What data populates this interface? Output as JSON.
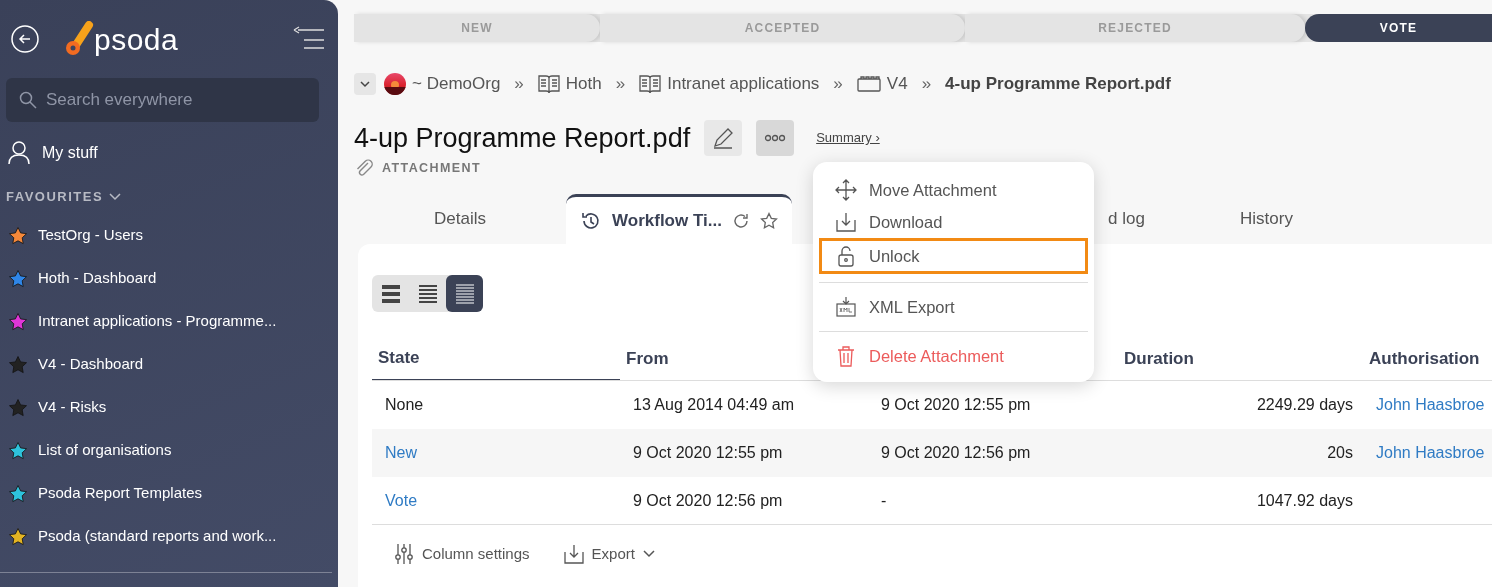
{
  "sidebar": {
    "logo": "psoda",
    "search": {
      "placeholder": "Search everywhere"
    },
    "my_stuff": "My stuff",
    "favourites": {
      "title": "FAVOURITES",
      "expanded": true,
      "items": [
        {
          "label": "TestOrg - Users",
          "color": "#f5883a"
        },
        {
          "label": "Hoth - Dashboard",
          "color": "#2f86e8"
        },
        {
          "label": "Intranet applications - Programme...",
          "color": "#e036d8"
        },
        {
          "label": "V4 - Dashboard",
          "color": "#222222"
        },
        {
          "label": "V4 - Risks",
          "color": "#222222"
        },
        {
          "label": "List of organisations",
          "color": "#2ec3dc"
        },
        {
          "label": "Psoda Report Templates",
          "color": "#2ec3dc"
        },
        {
          "label": "Psoda (standard reports and work...",
          "color": "#e3b423"
        }
      ]
    }
  },
  "stages": [
    {
      "label": "NEW",
      "selected": false
    },
    {
      "label": "ACCEPTED",
      "selected": false
    },
    {
      "label": "REJECTED",
      "selected": false
    },
    {
      "label": "VOTE",
      "selected": true
    }
  ],
  "breadcrumb": {
    "items": [
      {
        "label": "~ DemoOrg",
        "kind": "org",
        "separator": "»"
      },
      {
        "label": "Hoth",
        "kind": "book",
        "separator": "»"
      },
      {
        "label": "Intranet applications",
        "kind": "book",
        "separator": "»"
      },
      {
        "label": "V4",
        "kind": "board",
        "separator": "»"
      }
    ],
    "current": "4-up Programme Report.pdf"
  },
  "title": "4-up Programme Report.pdf",
  "summary_link": "Summary ›",
  "type_label": "ATTACHMENT",
  "tabs": [
    {
      "label": "Details",
      "selected": false
    },
    {
      "label": "Workflow Ti...",
      "selected": true
    },
    {
      "label": "d log",
      "selected": false
    },
    {
      "label": "History",
      "selected": false
    }
  ],
  "menu": [
    {
      "label": "Move Attachment",
      "kind": "move",
      "highlighted": false
    },
    {
      "label": "Download",
      "kind": "download",
      "highlighted": false
    },
    {
      "label": "Unlock",
      "kind": "unlock",
      "highlighted": true
    },
    {
      "label": "XML Export",
      "kind": "xml",
      "highlighted": false
    },
    {
      "label": "Delete Attachment",
      "kind": "delete",
      "highlighted": false
    }
  ],
  "view_modes": [
    {
      "selected": false
    },
    {
      "selected": false
    },
    {
      "selected": true
    }
  ],
  "table": {
    "columns": {
      "state": "State",
      "from": "From",
      "duration": "Duration",
      "authorisation": "Authorisation"
    },
    "rows": [
      {
        "state": "None",
        "link": false,
        "from": "13 Aug 2014 04:49 am",
        "column_3": "9 Oct 2020 12:55 pm",
        "duration": "2249.29 days",
        "authorisation": "John Haasbroe"
      },
      {
        "state": "New",
        "link": true,
        "from": "9 Oct 2020 12:55 pm",
        "column_3": "9 Oct 2020 12:56 pm",
        "duration": "20s",
        "authorisation": "John Haasbroe"
      },
      {
        "state": "Vote",
        "link": true,
        "from": "9 Oct 2020 12:56 pm",
        "column_3": "-",
        "duration": "1047.92 days"
      }
    ]
  },
  "footer": {
    "column_settings": "Column settings",
    "export": "Export"
  }
}
